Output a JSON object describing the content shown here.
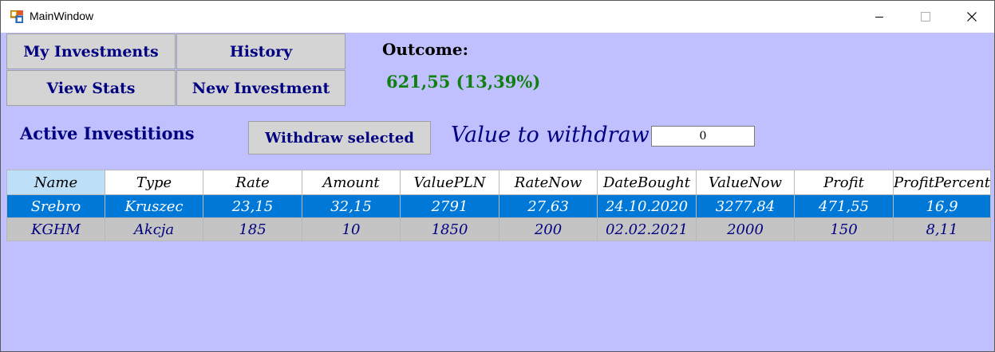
{
  "window": {
    "title": "MainWindow"
  },
  "nav": {
    "my_investments": "My Investments",
    "history": "History",
    "view_stats": "View Stats",
    "new_investment": "New Investment"
  },
  "outcome": {
    "label": "Outcome:",
    "value": "621,55 (13,39%)",
    "value_color": "#118011"
  },
  "active": {
    "label": "Active Investitions",
    "withdraw_button": "Withdraw selected",
    "withdraw_label": "Value to withdraw",
    "withdraw_value": "0"
  },
  "table": {
    "columns": [
      "Name",
      "Type",
      "Rate",
      "Amount",
      "ValuePLN",
      "RateNow",
      "DateBought",
      "ValueNow",
      "Profit",
      "ProfitPercent"
    ],
    "rows": [
      [
        "Srebro",
        "Kruszec",
        "23,15",
        "32,15",
        "2791",
        "27,63",
        "24.10.2020",
        "3277,84",
        "471,55",
        "16,9"
      ],
      [
        "KGHM",
        "Akcja",
        "185",
        "10",
        "1850",
        "200",
        "02.02.2021",
        "2000",
        "150",
        "8,11"
      ]
    ],
    "selected_row": 0
  },
  "colors": {
    "background": "#c0c0ff",
    "selection": "#0078d7",
    "text": "#000080"
  }
}
